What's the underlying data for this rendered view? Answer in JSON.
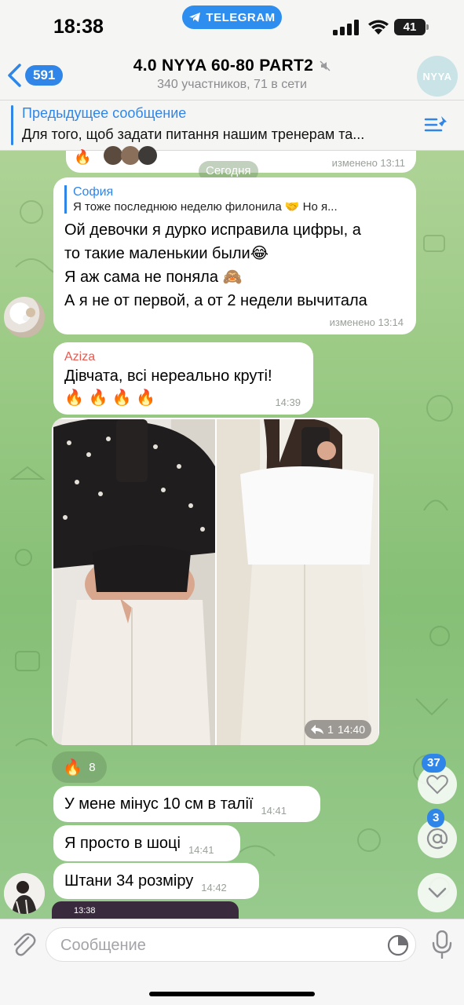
{
  "status_bar": {
    "time": "18:38",
    "telegram_label": "TELEGRAM",
    "battery": "41"
  },
  "header": {
    "back_count": "591",
    "title": "4.0 NYYA 60-80 PART2",
    "subtitle": "340 участников, 71 в сети",
    "avatar_text": "NYYA"
  },
  "pinned": {
    "title": "Предыдущее сообщение",
    "text": "Для того, щоб задати питання нашим тренерам та..."
  },
  "top_partial": {
    "time": "изменено 13:11"
  },
  "date_separator": "Сегодня",
  "messages": {
    "m1": {
      "reply_name": "София",
      "reply_text": "Я тоже последнюю неделю филонила 🤝 Но я...",
      "lines": [
        "Ой девочки я дурко исправила цифры, а",
        "то такие маленькии были😂",
        "Я аж сама не поняла 🙈",
        "А я не от первой, а от 2 недели вычитала"
      ],
      "time": "изменено 13:14"
    },
    "m2": {
      "sender": "Aziza",
      "text": "Дівчата, всі нереально круті!",
      "emoji": "🔥 🔥 🔥 🔥",
      "time": "14:39"
    },
    "photo": {
      "forwards": "1",
      "time": "14:40"
    },
    "reaction": {
      "emoji": "🔥",
      "count": "8"
    },
    "m3": {
      "text": "У мене мінус 10 см в талії",
      "time": "14:41"
    },
    "m4": {
      "text": "Я просто в шоці",
      "time": "14:41"
    },
    "m5": {
      "text": "Штани 34 розміру",
      "time": "14:42"
    },
    "preview_time": "13:38"
  },
  "side": {
    "reactions_badge": "37",
    "mentions_badge": "3"
  },
  "composer": {
    "placeholder": "Сообщение"
  },
  "colors": {
    "accent": "#2f86e8",
    "aziza": "#e85a4f"
  }
}
